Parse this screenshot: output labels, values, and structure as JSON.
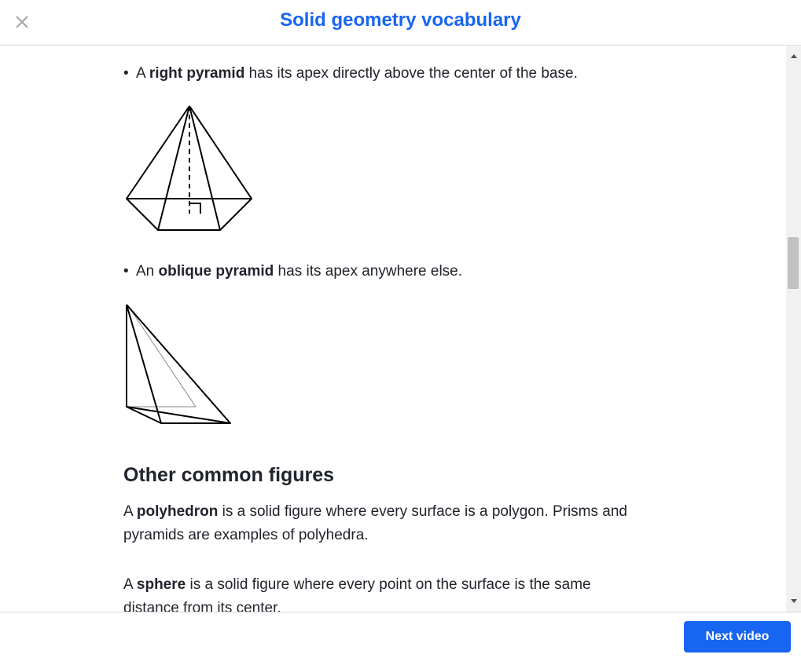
{
  "header": {
    "title": "Solid geometry vocabulary",
    "close_icon": "close-icon"
  },
  "content": {
    "bullet_right": {
      "prefix": "A ",
      "term": "right pyramid",
      "suffix": " has its apex directly above the center of the base."
    },
    "bullet_oblique": {
      "prefix": "An ",
      "term": "oblique pyramid",
      "suffix": " has its apex anywhere else."
    },
    "heading": "Other common figures",
    "para_polyhedron": {
      "prefix": "A ",
      "term": "polyhedron",
      "suffix": " is a solid figure where every surface is a polygon. Prisms and pyramids are examples of polyhedra."
    },
    "para_sphere": {
      "prefix": "A ",
      "term": "sphere",
      "suffix": " is a solid figure where every point on the surface is the same distance from its center."
    }
  },
  "footer": {
    "next_label": "Next video"
  },
  "colors": {
    "accent": "#1865f2",
    "text": "#21242c",
    "border": "#d6d8da"
  }
}
